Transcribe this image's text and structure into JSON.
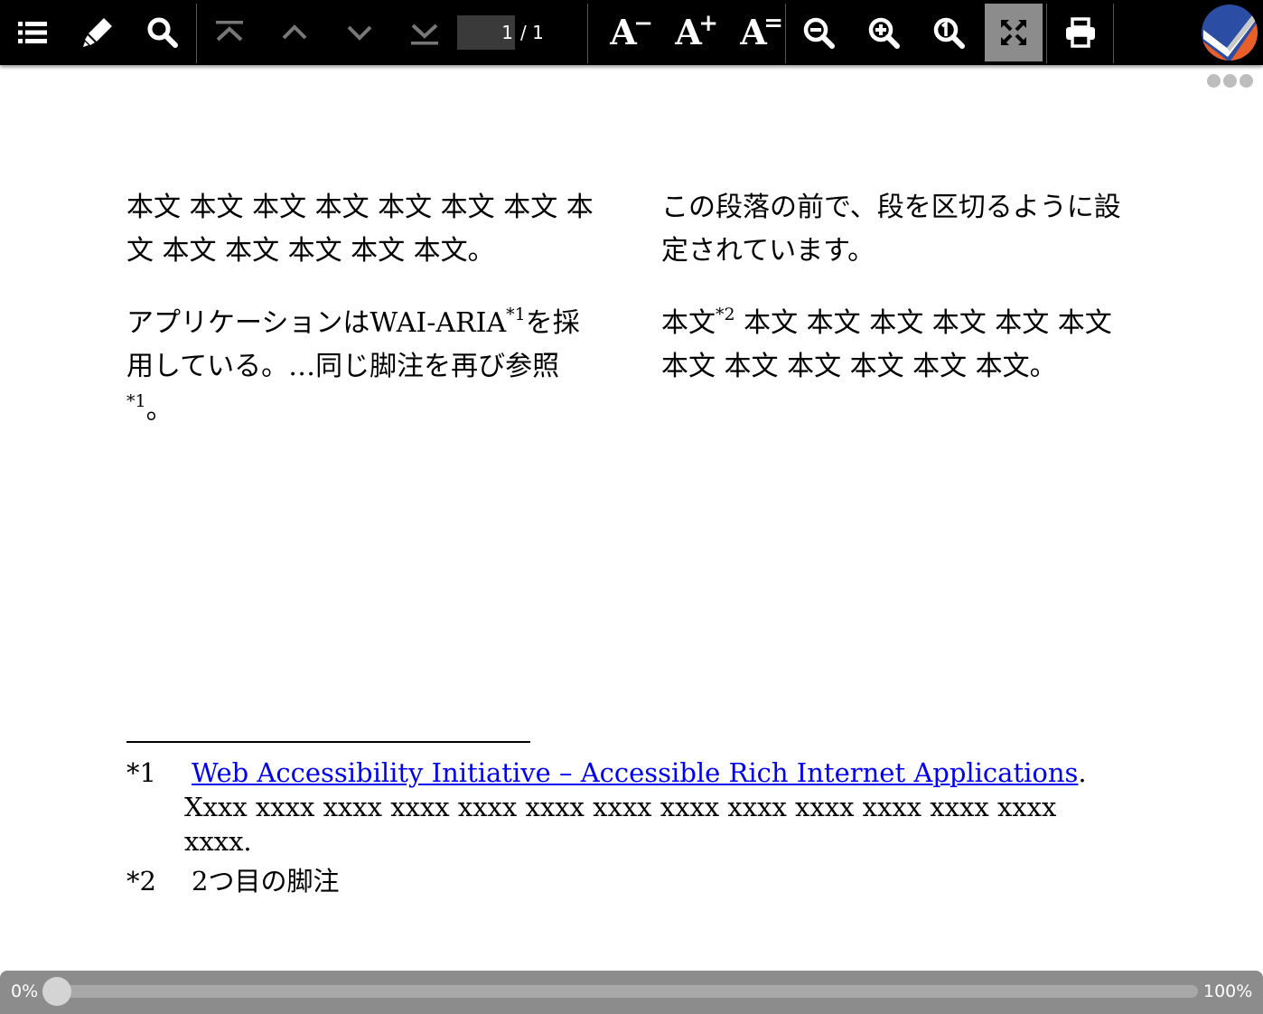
{
  "toolbar": {
    "page_current": "1",
    "page_total": "/ 1",
    "font_decrease_label": "A",
    "font_decrease_mark": "−",
    "font_increase_label": "A",
    "font_increase_mark": "+",
    "font_reset_label": "A",
    "font_reset_mark": "="
  },
  "content": {
    "left": {
      "p1": "本文 本文 本文 本文 本文 本文 本文 本文 本文 本文 本文 本文 本文。",
      "p2_a": "アプリケーションはWAI-ARIA",
      "p2_ref1": "*1",
      "p2_b": "を採用している。…同じ脚注を再び参照",
      "p2_ref2": "*1",
      "p2_c": "。"
    },
    "right": {
      "p1": "この段落の前で、段を区切るように設定されています。",
      "p2_a": "本文",
      "p2_ref": "*2",
      "p2_b": " 本文 本文 本文 本文 本文 本文 本文 本文 本文 本文 本文 本文。"
    }
  },
  "footnotes": [
    {
      "mark": "*1",
      "link_text": "Web Accessibility Initiative – Accessible Rich Internet Applications",
      "text": ". Xxxx xxxx xxxx xxxx xxxx xxxx xxxx xxxx xxxx xxxx xxxx xxxx xxxx xxxx."
    },
    {
      "mark": "*2",
      "text": "2つ目の脚注"
    }
  ],
  "progress": {
    "start_label": "0%",
    "end_label": "100%",
    "value_percent": 0
  },
  "colors": {
    "toolbar_bg": "#000000",
    "link": "#0000ee",
    "active_button": "#8c8c8c",
    "progress_bg": "#8c8c8c"
  },
  "icons": {
    "toc": "list-icon",
    "annotate": "highlighter-icon",
    "search": "search-icon",
    "first_page": "first-page-icon",
    "prev_page": "chevron-up-icon",
    "next_page": "chevron-down-icon",
    "last_page": "last-page-icon",
    "zoom_out": "zoom-out-icon",
    "zoom_in": "zoom-in-icon",
    "zoom_reset": "zoom-reset-icon",
    "fullscreen": "fullscreen-icon",
    "print": "print-icon",
    "more": "more-dots-icon",
    "logo": "vivliostyle-logo"
  }
}
